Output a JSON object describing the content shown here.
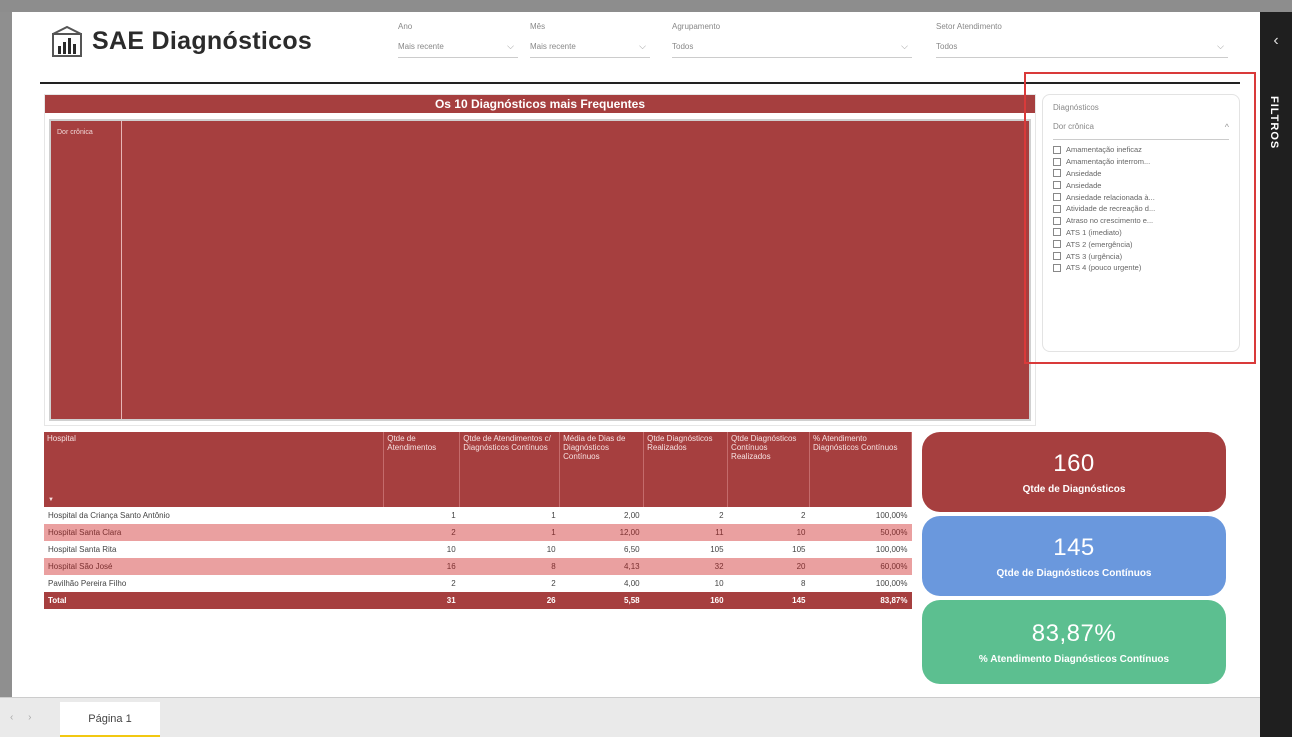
{
  "app": {
    "title": "SAE Diagnósticos"
  },
  "slicers": [
    {
      "label": "Ano",
      "value": "Mais recente"
    },
    {
      "label": "Mês",
      "value": "Mais recente"
    },
    {
      "label": "Agrupamento",
      "value": "Todos"
    },
    {
      "label": "Setor Atendimento",
      "value": "Todos"
    }
  ],
  "chart": {
    "title": "Os 10 Diagnósticos mais Frequentes",
    "legend": "Dor crônica"
  },
  "diagnostics_filter": {
    "label": "Diagnósticos",
    "selected": "Dor crônica",
    "options": [
      "Amamentação ineficaz",
      "Amamentação interrom...",
      "Ansiedade",
      "Ansiedade",
      "Ansiedade relacionada à...",
      "Atividade de recreação d...",
      "Atraso no crescimento e...",
      "ATS 1 (imediato)",
      "ATS 2 (emergência)",
      "ATS 3 (urgência)",
      "ATS 4 (pouco urgente)"
    ]
  },
  "table": {
    "headers": [
      "Hospital",
      "Qtde de Atendimentos",
      "Qtde de Atendimentos c/ Diagnósticos Contínuos",
      "Média de Dias de Diagnósticos Contínuos",
      "Qtde Diagnósticos Realizados",
      "Qtde Diagnósticos Contínuos Realizados",
      "% Atendimento Diagnósticos Contínuos"
    ],
    "rows": [
      [
        "Hospital da Criança Santo Antônio",
        "1",
        "1",
        "2,00",
        "2",
        "2",
        "100,00%"
      ],
      [
        "Hospital Santa Clara",
        "2",
        "1",
        "12,00",
        "11",
        "10",
        "50,00%"
      ],
      [
        "Hospital Santa Rita",
        "10",
        "10",
        "6,50",
        "105",
        "105",
        "100,00%"
      ],
      [
        "Hospital São José",
        "16",
        "8",
        "4,13",
        "32",
        "20",
        "60,00%"
      ],
      [
        "Pavilhão Pereira Filho",
        "2",
        "2",
        "4,00",
        "10",
        "8",
        "100,00%"
      ]
    ],
    "total": [
      "Total",
      "31",
      "26",
      "5,58",
      "160",
      "145",
      "83,87%"
    ]
  },
  "cards": [
    {
      "value": "160",
      "caption": "Qtde de Diagnósticos"
    },
    {
      "value": "145",
      "caption": "Qtde de Diagnósticos Contínuos"
    },
    {
      "value": "83,87%",
      "caption": "% Atendimento Diagnósticos Contínuos"
    }
  ],
  "filters_pane": {
    "label": "FILTROS"
  },
  "pages": {
    "current": "Página 1"
  },
  "colors": {
    "primary": "#a63f3f",
    "blue": "#6a98dd",
    "green": "#5cbf90",
    "row_alt": "#eaa0a0"
  }
}
